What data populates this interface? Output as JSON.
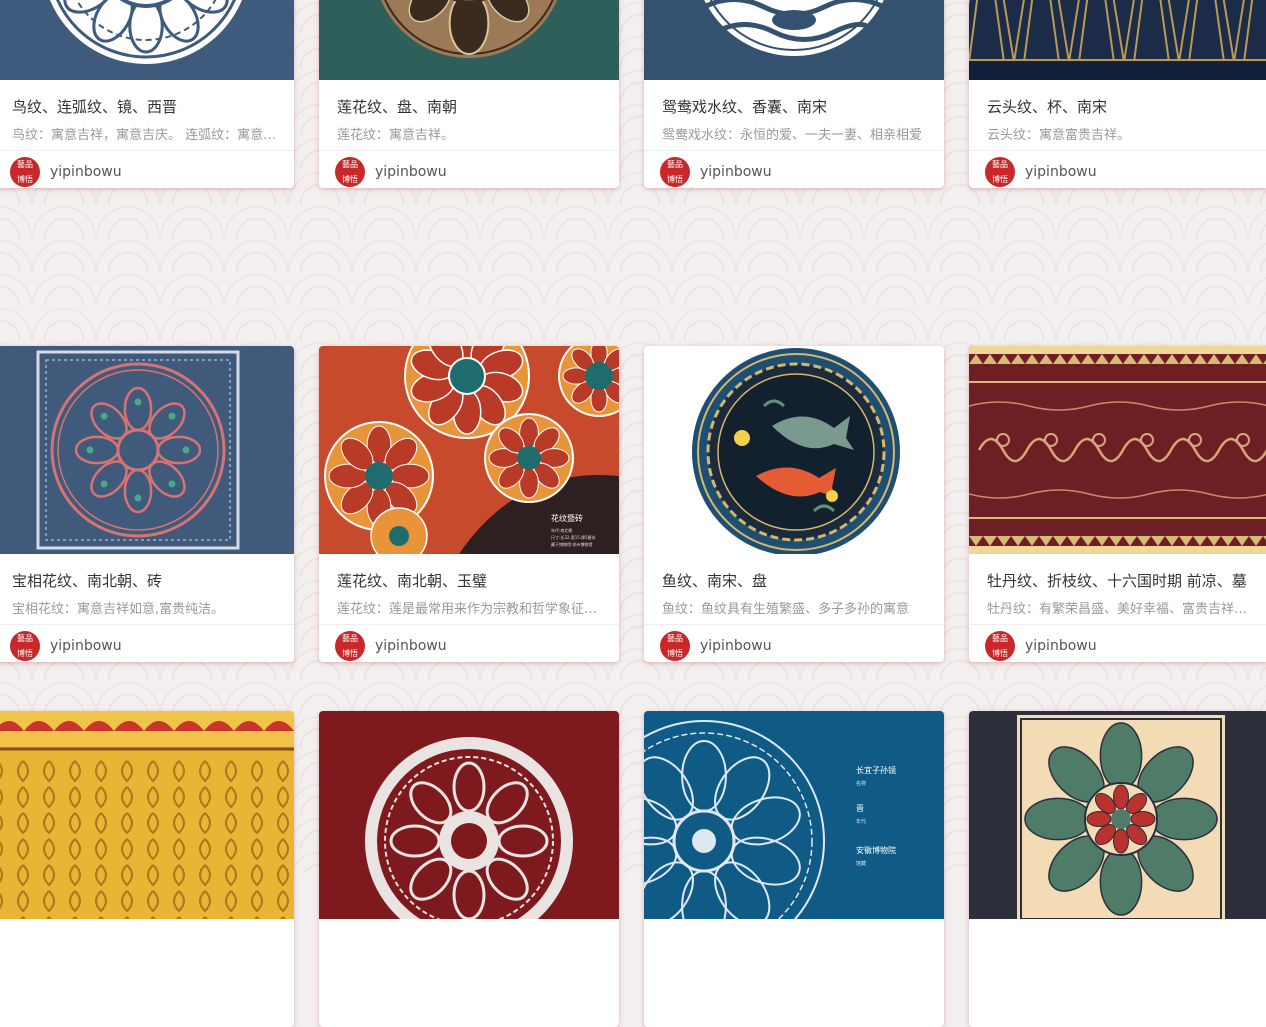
{
  "cards": [
    {
      "title": "鸟纹、连弧纹、镜、西晋",
      "desc": "鸟纹：寓意吉祥，寓意吉庆。 连弧纹：寓意吉祥",
      "author": "yipinbowu",
      "image": "bird-arc-mirror-pattern",
      "bg": "#3e5a7c"
    },
    {
      "title": "莲花纹、盘、南朝",
      "desc": "莲花纹：寓意吉祥。",
      "author": "yipinbowu",
      "image": "lotus-plate-pattern",
      "bg": "#2e5f5b"
    },
    {
      "title": "鸳鸯戏水纹、香囊、南宋",
      "desc": "鸳鸯戏水纹：永恒的爱、一夫一妻、相亲相爱",
      "author": "yipinbowu",
      "image": "mandarin-duck-sachet-pattern",
      "bg": "#34526f"
    },
    {
      "title": "云头纹、杯、南宋",
      "desc": "云头纹：寓意富贵吉祥。",
      "author": "yipinbowu",
      "image": "cloud-head-cup-pattern",
      "bg": "#1c2b47"
    },
    {
      "title": "宝相花纹、南北朝、砖",
      "desc": "宝相花纹：寓意吉祥如意,富贵纯洁。",
      "author": "yipinbowu",
      "image": "baoxiang-flower-brick-pattern",
      "bg": "#3f5a7a"
    },
    {
      "title": "莲花纹、南北朝、玉璧",
      "desc": "莲花纹：莲是最常用来作为宗教和哲学象征的植物",
      "author": "yipinbowu",
      "image": "lotus-jade-bi-pattern",
      "bg": "#e38a3d"
    },
    {
      "title": "鱼纹、南宋、盘",
      "desc": "鱼纹：鱼纹具有生殖繁盛、多子多孙的寓意",
      "author": "yipinbowu",
      "image": "fish-plate-pattern",
      "bg": "#ffffff"
    },
    {
      "title": "牡丹纹、折枝纹、十六国时期 前凉、墓",
      "desc": "牡丹纹：有繁荣昌盛、美好幸福、富贵吉祥的寓意",
      "author": "yipinbowu",
      "image": "peony-branch-pattern",
      "bg": "#6e1f24"
    },
    {
      "title": "",
      "desc": "",
      "author": "",
      "image": "yellow-cloud-pattern",
      "bg": "#e9b535"
    },
    {
      "title": "",
      "desc": "",
      "author": "",
      "image": "red-mirror-pattern",
      "bg": "#7e1a1e"
    },
    {
      "title": "",
      "desc": "",
      "author": "",
      "image": "blue-mirror-pattern",
      "bg": "#0f5b86",
      "overlay_text": [
        "长宜子孙镜",
        "名称",
        "晋",
        "年代",
        "安徽博物院",
        "馆藏"
      ]
    },
    {
      "title": "",
      "desc": "",
      "author": "",
      "image": "green-flower-tile-pattern",
      "bg": "#2d2f3c"
    }
  ],
  "thumb_texts": {
    "lotus_bi": [
      "花纹暨砖",
      "年代:南北朝",
      "尺寸:长32.宽15.厚5厘米",
      "藏于博物馆:徐州博物馆"
    ]
  },
  "avatar_chars": [
    "藝",
    "品",
    "博",
    "悟"
  ]
}
